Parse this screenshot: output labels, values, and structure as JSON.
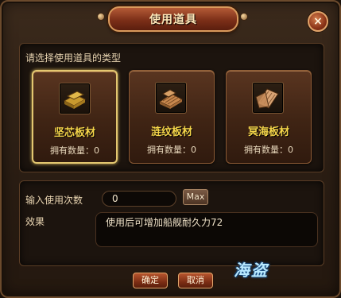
{
  "dialog": {
    "title": "使用道具",
    "close_label": "×"
  },
  "hint": "请选择使用道具的类型",
  "items": [
    {
      "name": "坚芯板材",
      "quantity": "拥有数量：0",
      "icon": "wood-plank-icon",
      "selected": true
    },
    {
      "name": "涟纹板材",
      "quantity": "拥有数量：0",
      "icon": "wood-plank-icon",
      "selected": false
    },
    {
      "name": "冥海板材",
      "quantity": "拥有数量：0",
      "icon": "wood-plank-icon",
      "selected": false
    }
  ],
  "usage": {
    "count_label": "输入使用次数",
    "count_value": "0",
    "max_label": "Max",
    "effect_label": "效果",
    "effect_text": "使用后可增加船舰耐久力72"
  },
  "buttons": {
    "confirm": "确定",
    "cancel": "取消"
  },
  "logo_text": "海盗",
  "colors": {
    "accent_gold": "#f5d54a",
    "title_red": "#7c2f18",
    "selected_border": "#e3c770"
  }
}
